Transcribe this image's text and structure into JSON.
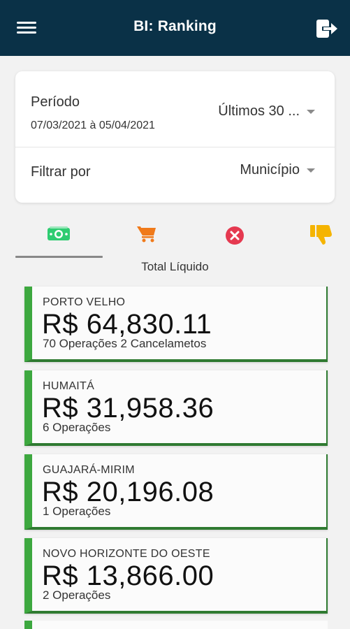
{
  "header": {
    "title": "BI: Ranking",
    "menu_icon": "menu-icon",
    "logout_icon": "logout-icon"
  },
  "filters": {
    "periodo_label": "Período",
    "periodo_dates": "07/03/2021 à 05/04/2021",
    "periodo_value": "Últimos 30 ...",
    "filtrar_label": "Filtrar por",
    "filtrar_value": "Município"
  },
  "tabs": {
    "items": [
      {
        "icon": "money-icon",
        "color": "#2ecc71",
        "selected": true
      },
      {
        "icon": "cart-icon",
        "color": "#f07a1a",
        "selected": false
      },
      {
        "icon": "cancel-icon",
        "color": "#e53950",
        "selected": false
      },
      {
        "icon": "thumbs-down-icon",
        "color": "#f5b400",
        "selected": false
      }
    ],
    "caption": "Total Líquido"
  },
  "ranking": [
    {
      "city": "PORTO VELHO",
      "amount": "R$ 64,830.11",
      "ops": "70 Operações 2 Cancelametos"
    },
    {
      "city": "HUMAITÁ",
      "amount": "R$ 31,958.36",
      "ops": "6 Operações"
    },
    {
      "city": "GUAJARÁ-MIRIM",
      "amount": "R$ 20,196.08",
      "ops": "1 Operações"
    },
    {
      "city": "NOVO HORIZONTE DO OESTE",
      "amount": "R$ 13,866.00",
      "ops": "2 Operações"
    }
  ],
  "colors": {
    "appbar": "#0a3147",
    "card_accent": "#3da83f"
  }
}
